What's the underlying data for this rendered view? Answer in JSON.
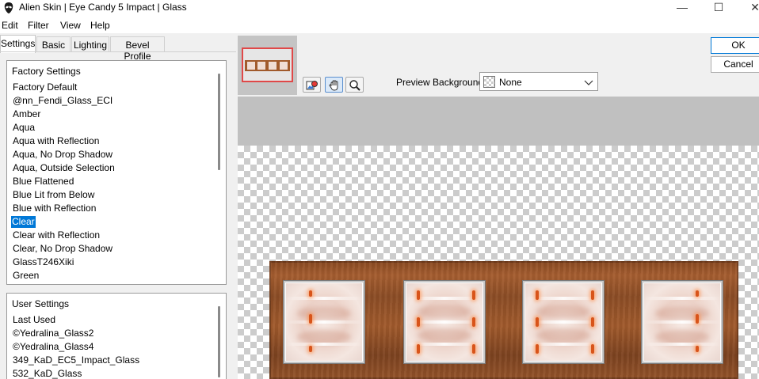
{
  "window": {
    "title": "Alien Skin | Eye Candy 5 Impact | Glass",
    "minimize": "—",
    "maximize": "☐",
    "close": "✕"
  },
  "menu": [
    "Edit",
    "Filter",
    "View",
    "Help"
  ],
  "tabs": [
    "Settings",
    "Basic",
    "Lighting",
    "Bevel Profile"
  ],
  "active_tab": "Settings",
  "factory_settings": {
    "heading": "Factory Settings",
    "selected": "Clear",
    "items": [
      "Factory Default",
      "@nn_Fendi_Glass_ECI",
      "Amber",
      "Aqua",
      "Aqua with Reflection",
      "Aqua, No Drop Shadow",
      "Aqua, Outside Selection",
      "Blue Flattened",
      "Blue Lit from Below",
      "Blue with Reflection",
      "Clear",
      "Clear with Reflection",
      "Clear, No Drop Shadow",
      "GlassT246Xiki",
      "Green"
    ]
  },
  "user_settings": {
    "heading": "User Settings",
    "items": [
      "Last Used",
      "©Yedralina_Glass2",
      "©Yedralina_Glass4",
      "349_KaD_EC5_Impact_Glass",
      "532_KaD_Glass"
    ]
  },
  "preview": {
    "background_label": "Preview Background:",
    "background_value": "None",
    "tools": [
      "preview-icon",
      "hand-icon",
      "zoom-icon"
    ],
    "active_tool": "hand-icon"
  },
  "buttons": {
    "ok": "OK",
    "cancel": "Cancel"
  },
  "colors": {
    "selection": "#0078d7",
    "wood": "#94532a",
    "thumbnail_frame": "#e04848"
  }
}
